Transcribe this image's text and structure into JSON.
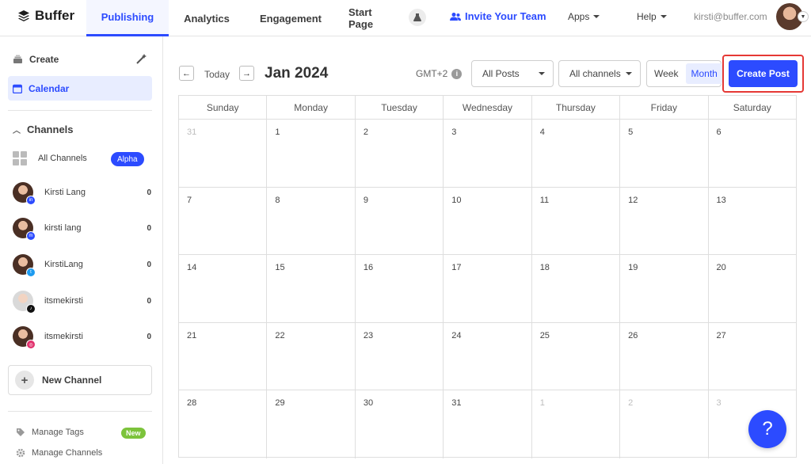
{
  "nav": {
    "logo": "Buffer",
    "tabs": [
      {
        "label": "Publishing",
        "active": true
      },
      {
        "label": "Analytics"
      },
      {
        "label": "Engagement"
      },
      {
        "label": "Start Page"
      }
    ],
    "invite": "Invite Your Team",
    "apps": "Apps",
    "help": "Help",
    "email": "kirsti@buffer.com"
  },
  "sidebar": {
    "create": "Create",
    "calendar": "Calendar",
    "channels_heading": "Channels",
    "all_channels": "All Channels",
    "alpha_badge": "Alpha",
    "channels": [
      {
        "name": "Kirsti Lang",
        "count": "0",
        "network": "linkedin",
        "badge_color": "#2c4bff"
      },
      {
        "name": "kirsti lang",
        "count": "0",
        "network": "mastodon",
        "badge_color": "#2c4bff"
      },
      {
        "name": "KirstiLang",
        "count": "0",
        "network": "twitter",
        "badge_color": "#1d9bf0"
      },
      {
        "name": "itsmekirsti",
        "count": "0",
        "network": "tiktok",
        "badge_color": "#111111"
      },
      {
        "name": "itsmekirsti",
        "count": "0",
        "network": "instagram",
        "badge_color": "#e1306c"
      }
    ],
    "new_channel": "New Channel",
    "manage_tags": "Manage Tags",
    "new_badge": "New",
    "manage_channels": "Manage Channels"
  },
  "toolbar": {
    "today": "Today",
    "month_title": "Jan 2024",
    "timezone": "GMT+2",
    "posts_filter": "All Posts",
    "channels_filter": "All channels",
    "view_week": "Week",
    "view_month": "Month",
    "create_post": "Create Post"
  },
  "calendar": {
    "weekdays": [
      "Sunday",
      "Monday",
      "Tuesday",
      "Wednesday",
      "Thursday",
      "Friday",
      "Saturday"
    ],
    "weeks": [
      [
        {
          "d": "31",
          "m": true
        },
        {
          "d": "1"
        },
        {
          "d": "2"
        },
        {
          "d": "3"
        },
        {
          "d": "4"
        },
        {
          "d": "5"
        },
        {
          "d": "6"
        }
      ],
      [
        {
          "d": "7"
        },
        {
          "d": "8"
        },
        {
          "d": "9"
        },
        {
          "d": "10"
        },
        {
          "d": "11"
        },
        {
          "d": "12"
        },
        {
          "d": "13"
        }
      ],
      [
        {
          "d": "14"
        },
        {
          "d": "15"
        },
        {
          "d": "16"
        },
        {
          "d": "17"
        },
        {
          "d": "18"
        },
        {
          "d": "19"
        },
        {
          "d": "20"
        }
      ],
      [
        {
          "d": "21"
        },
        {
          "d": "22"
        },
        {
          "d": "23"
        },
        {
          "d": "24"
        },
        {
          "d": "25"
        },
        {
          "d": "26"
        },
        {
          "d": "27"
        }
      ],
      [
        {
          "d": "28"
        },
        {
          "d": "29"
        },
        {
          "d": "30"
        },
        {
          "d": "31"
        },
        {
          "d": "1",
          "m": true
        },
        {
          "d": "2",
          "m": true
        },
        {
          "d": "3",
          "m": true
        }
      ]
    ]
  },
  "help_button": "?",
  "colors": {
    "accent": "#2c4bff",
    "highlight": "#e53935"
  }
}
